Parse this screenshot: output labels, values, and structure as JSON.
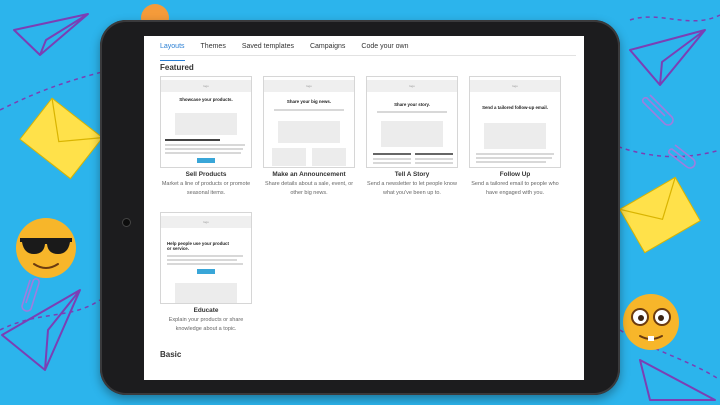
{
  "tabs": [
    {
      "label": "Layouts",
      "active": true
    },
    {
      "label": "Themes"
    },
    {
      "label": "Saved templates"
    },
    {
      "label": "Campaigns"
    },
    {
      "label": "Code your own"
    }
  ],
  "sections": {
    "featured": "Featured",
    "basic": "Basic"
  },
  "templates": [
    {
      "title": "Sell Products",
      "description": "Market a line of products or promote seasonal items.",
      "thumb_logo": "logo",
      "thumb_heading": "Showcase your products."
    },
    {
      "title": "Make an Announcement",
      "description": "Share details about a sale, event, or other big news.",
      "thumb_logo": "logo",
      "thumb_heading": "Share your big news."
    },
    {
      "title": "Tell A Story",
      "description": "Send a newsletter to let people know what you've been up to.",
      "thumb_logo": "logo",
      "thumb_heading": "Share your story."
    },
    {
      "title": "Follow Up",
      "description": "Send a tailored email to people who have engaged with you.",
      "thumb_logo": "logo",
      "thumb_heading": "Send a tailored follow-up email."
    },
    {
      "title": "Educate",
      "description": "Explain your products or share knowledge about a topic.",
      "thumb_logo": "logo",
      "thumb_heading": "Help people use your product or service."
    }
  ],
  "colors": {
    "background": "#2cb4ec",
    "tablet": "#1c1c1e",
    "accent": "#2a7fd4",
    "envelope": "#ffe14a",
    "plane_stroke": "#7b3fb5"
  },
  "decorations": [
    "paper-plane-icon",
    "envelope-icon",
    "paperclip-icon",
    "sunglasses-emoji-icon",
    "nerd-emoji-icon"
  ]
}
